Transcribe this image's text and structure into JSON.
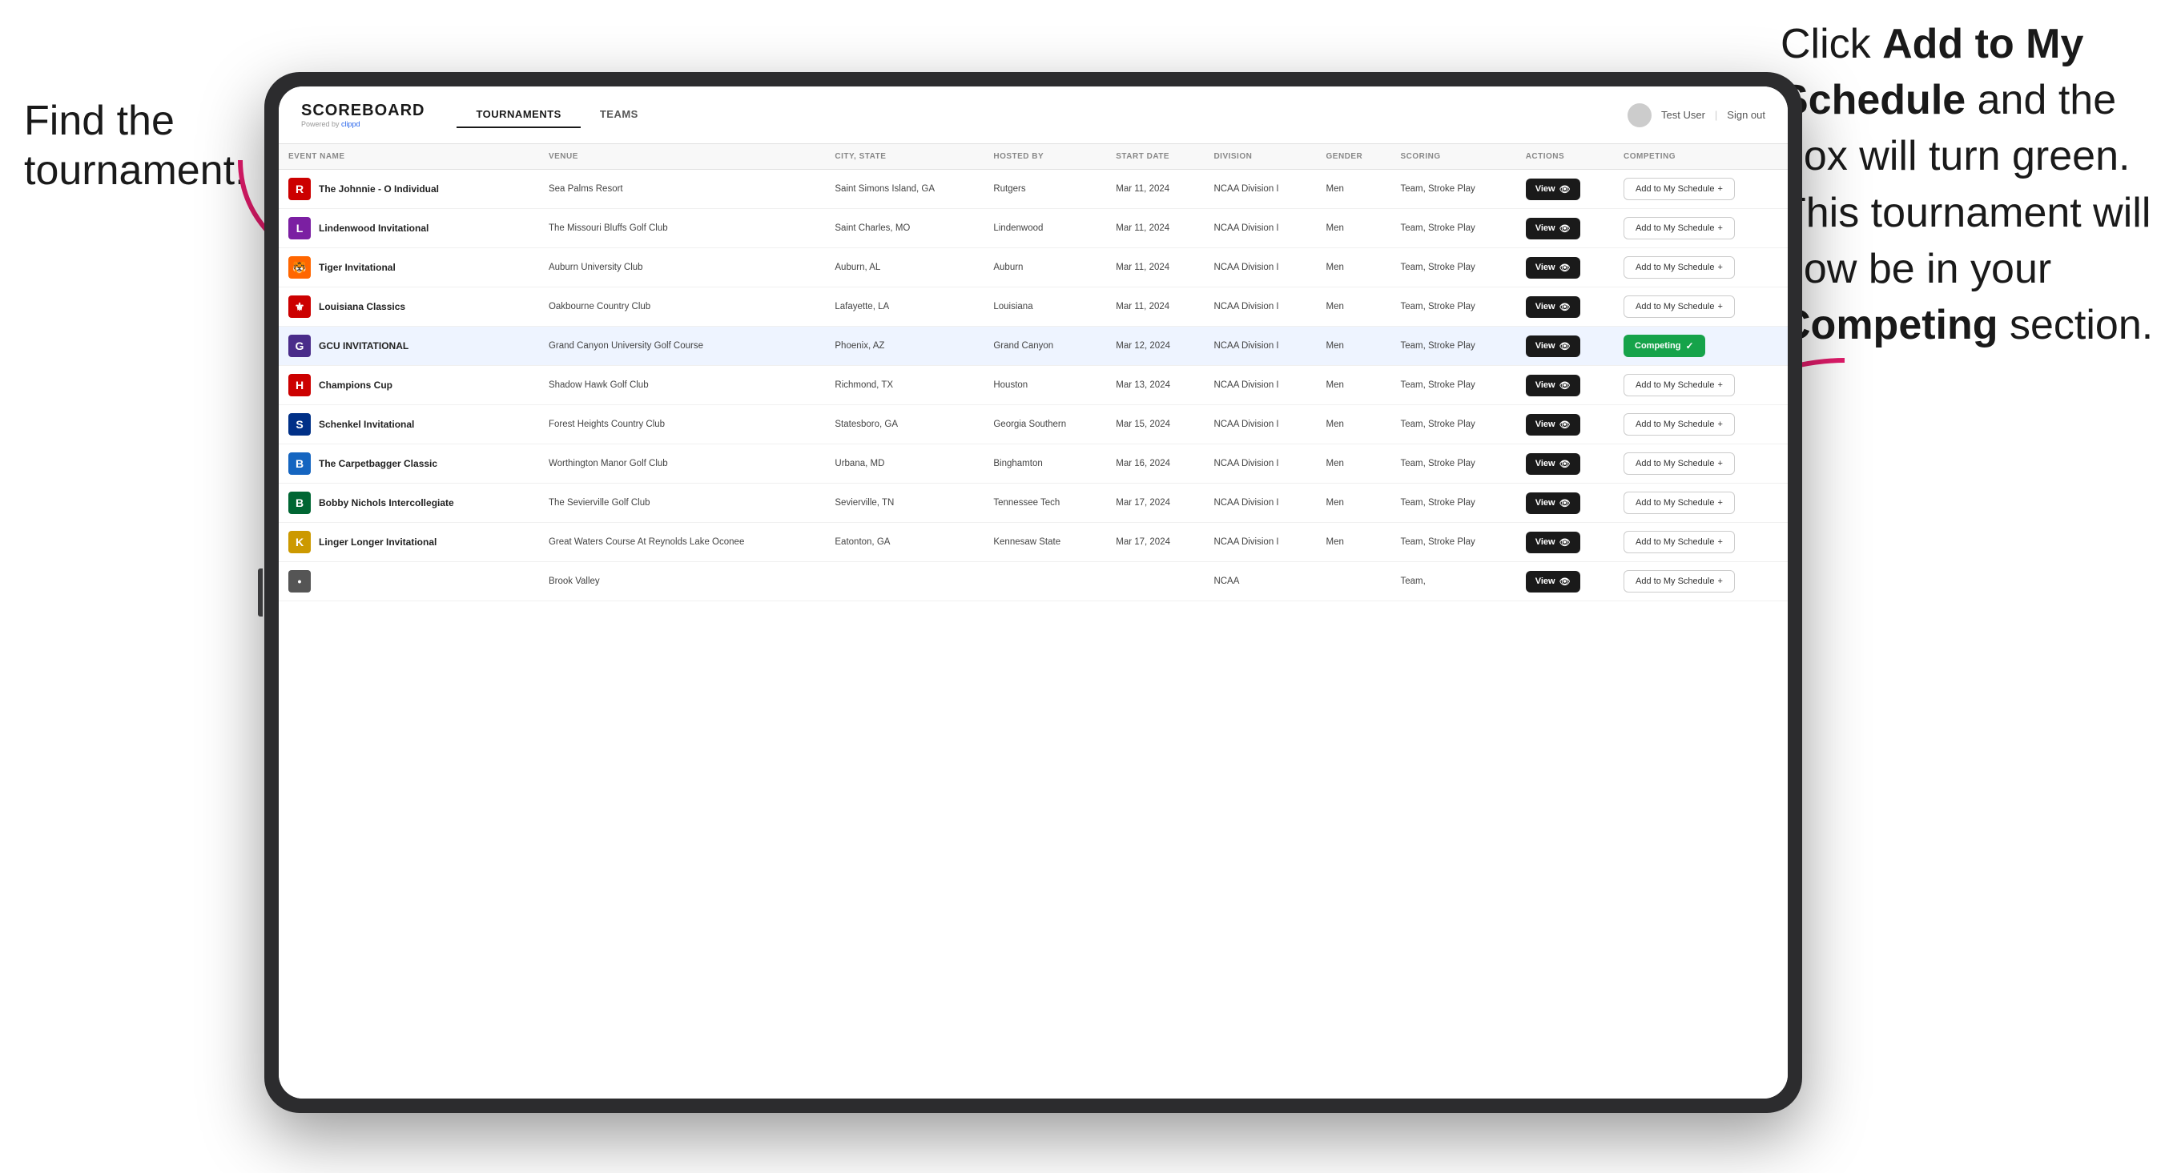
{
  "annotations": {
    "left": "Find the\ntournament.",
    "right_line1": "Click ",
    "right_bold1": "Add to My\nSchedule",
    "right_line2": " and the\nbox will turn green.\nThis tournament\nwill now be in\nyour ",
    "right_bold2": "Competing",
    "right_line3": "\nsection."
  },
  "app": {
    "logo": "SCOREBOARD",
    "powered_by": "Powered by",
    "clippd": "clippd",
    "nav_tabs": [
      "TOURNAMENTS",
      "TEAMS"
    ],
    "active_tab": "TOURNAMENTS",
    "user": "Test User",
    "sign_out": "Sign out"
  },
  "table": {
    "columns": [
      "EVENT NAME",
      "VENUE",
      "CITY, STATE",
      "HOSTED BY",
      "START DATE",
      "DIVISION",
      "GENDER",
      "SCORING",
      "ACTIONS",
      "COMPETING"
    ],
    "rows": [
      {
        "logo_color": "#cc0000",
        "logo_text": "R",
        "event_name": "The Johnnie - O Individual",
        "venue": "Sea Palms Resort",
        "city_state": "Saint Simons Island, GA",
        "hosted_by": "Rutgers",
        "start_date": "Mar 11, 2024",
        "division": "NCAA Division I",
        "gender": "Men",
        "scoring": "Team, Stroke Play",
        "action": "View",
        "competing_status": "add",
        "competing_label": "Add to My Schedule +"
      },
      {
        "logo_color": "#003087",
        "logo_text": "L",
        "event_name": "Lindenwood Invitational",
        "venue": "The Missouri Bluffs Golf Club",
        "city_state": "Saint Charles, MO",
        "hosted_by": "Lindenwood",
        "start_date": "Mar 11, 2024",
        "division": "NCAA Division I",
        "gender": "Men",
        "scoring": "Team, Stroke Play",
        "action": "View",
        "competing_status": "add",
        "competing_label": "Add to My Schedule +"
      },
      {
        "logo_color": "#ff6600",
        "logo_text": "🐯",
        "event_name": "Tiger Invitational",
        "venue": "Auburn University Club",
        "city_state": "Auburn, AL",
        "hosted_by": "Auburn",
        "start_date": "Mar 11, 2024",
        "division": "NCAA Division I",
        "gender": "Men",
        "scoring": "Team, Stroke Play",
        "action": "View",
        "competing_status": "add",
        "competing_label": "Add to My Schedule +"
      },
      {
        "logo_color": "#cc0000",
        "logo_text": "⚜",
        "event_name": "Louisiana Classics",
        "venue": "Oakbourne Country Club",
        "city_state": "Lafayette, LA",
        "hosted_by": "Louisiana",
        "start_date": "Mar 11, 2024",
        "division": "NCAA Division I",
        "gender": "Men",
        "scoring": "Team, Stroke Play",
        "action": "View",
        "competing_status": "add",
        "competing_label": "Add to My Schedule +"
      },
      {
        "logo_color": "#4a2c8a",
        "logo_text": "G",
        "event_name": "GCU INVITATIONAL",
        "venue": "Grand Canyon University Golf Course",
        "city_state": "Phoenix, AZ",
        "hosted_by": "Grand Canyon",
        "start_date": "Mar 12, 2024",
        "division": "NCAA Division I",
        "gender": "Men",
        "scoring": "Team, Stroke Play",
        "action": "View",
        "competing_status": "competing",
        "competing_label": "Competing ✓",
        "highlighted": true
      },
      {
        "logo_color": "#cc0000",
        "logo_text": "H",
        "event_name": "Champions Cup",
        "venue": "Shadow Hawk Golf Club",
        "city_state": "Richmond, TX",
        "hosted_by": "Houston",
        "start_date": "Mar 13, 2024",
        "division": "NCAA Division I",
        "gender": "Men",
        "scoring": "Team, Stroke Play",
        "action": "View",
        "competing_status": "add",
        "competing_label": "Add to My Schedule +"
      },
      {
        "logo_color": "#003087",
        "logo_text": "S",
        "event_name": "Schenkel Invitational",
        "venue": "Forest Heights Country Club",
        "city_state": "Statesboro, GA",
        "hosted_by": "Georgia Southern",
        "start_date": "Mar 15, 2024",
        "division": "NCAA Division I",
        "gender": "Men",
        "scoring": "Team, Stroke Play",
        "action": "View",
        "competing_status": "add",
        "competing_label": "Add to My Schedule +"
      },
      {
        "logo_color": "#003087",
        "logo_text": "B",
        "event_name": "The Carpetbagger Classic",
        "venue": "Worthington Manor Golf Club",
        "city_state": "Urbana, MD",
        "hosted_by": "Binghamton",
        "start_date": "Mar 16, 2024",
        "division": "NCAA Division I",
        "gender": "Men",
        "scoring": "Team, Stroke Play",
        "action": "View",
        "competing_status": "add",
        "competing_label": "Add to My Schedule +"
      },
      {
        "logo_color": "#006633",
        "logo_text": "B",
        "event_name": "Bobby Nichols Intercollegiate",
        "venue": "The Sevierville Golf Club",
        "city_state": "Sevierville, TN",
        "hosted_by": "Tennessee Tech",
        "start_date": "Mar 17, 2024",
        "division": "NCAA Division I",
        "gender": "Men",
        "scoring": "Team, Stroke Play",
        "action": "View",
        "competing_status": "add",
        "competing_label": "Add to My Schedule +"
      },
      {
        "logo_color": "#cc9900",
        "logo_text": "K",
        "event_name": "Linger Longer Invitational",
        "venue": "Great Waters Course At Reynolds Lake Oconee",
        "city_state": "Eatonton, GA",
        "hosted_by": "Kennesaw State",
        "start_date": "Mar 17, 2024",
        "division": "NCAA Division I",
        "gender": "Men",
        "scoring": "Team, Stroke Play",
        "action": "View",
        "competing_status": "add",
        "competing_label": "Add to My Schedule +"
      },
      {
        "logo_color": "#555",
        "logo_text": "•",
        "event_name": "",
        "venue": "Brook Valley",
        "city_state": "",
        "hosted_by": "",
        "start_date": "",
        "division": "NCAA",
        "gender": "",
        "scoring": "Team,",
        "action": "View",
        "competing_status": "add",
        "competing_label": "Add to My Schedule +"
      }
    ]
  }
}
